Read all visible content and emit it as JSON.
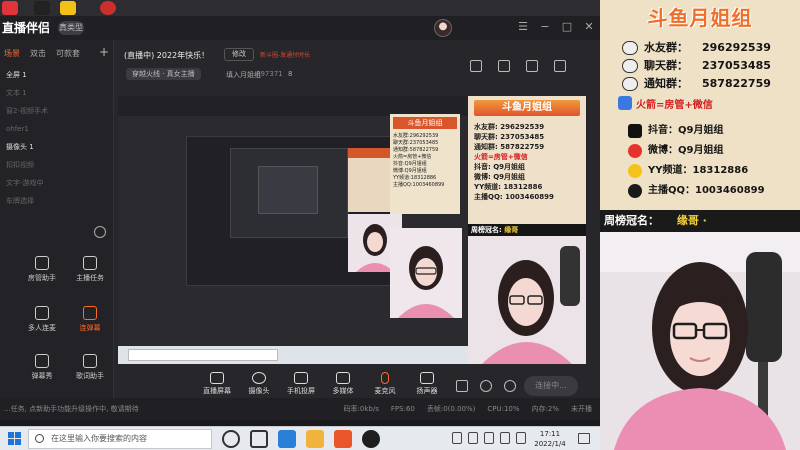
{
  "app": {
    "logo_text": "直播伴侣",
    "version_label": "真类型",
    "window_controls": [
      "☰",
      "−",
      "□",
      "✕"
    ]
  },
  "sidebar": {
    "tabs": [
      "场景",
      "双击",
      "可款套"
    ],
    "scenes": [
      {
        "label": "全屏 1",
        "bright": true
      },
      {
        "label": "文本 1",
        "bright": false
      },
      {
        "label": "窗2-视频手术",
        "bright": false
      },
      {
        "label": "ohfer1",
        "bright": false
      },
      {
        "label": "摄像头 1",
        "bright": true
      },
      {
        "label": "扣扣视频",
        "bright": false
      },
      {
        "label": "文字-游戏中",
        "bright": false
      },
      {
        "label": "车牌选择",
        "bright": false
      }
    ],
    "tools": [
      {
        "label": "房管助手",
        "hot": false
      },
      {
        "label": "主播任务",
        "hot": false
      },
      {
        "label": "多人连麦",
        "hot": false
      },
      {
        "label": "连弹幕",
        "hot": true
      },
      {
        "label": "弹幕秀",
        "hot": false
      },
      {
        "label": "歌词助手",
        "hot": false
      }
    ]
  },
  "room": {
    "title": "(直播中) 2022年快乐！",
    "modify_label": "修改",
    "warning": "新斗圈-发通付时长",
    "category": "穿越火线 · 真女主播",
    "subtitle": "填入月姐组",
    "room_id": "897371",
    "fans": "8"
  },
  "preview": {
    "big_panel_title": "斗鱼月姐组",
    "big_panel_lines": [
      "水友群: 296292539",
      "聊天群: 237053485",
      "通知群: 587822759",
      "火箭=房管+微信",
      "抖音: Q9月姐组",
      "微博: Q9月姐组",
      "YY频道: 18312886",
      "主播QQ: 1003460899"
    ],
    "crown_label": "周榜冠名:",
    "crown_name": "缘哥",
    "mini_panel_title": "斗鱼月姐组",
    "mini_panel_lines": [
      "水友群:296292539",
      "聊天群:237053485",
      "通知群:587822759",
      "火箭=房管+微信",
      "抖音:Q9月姐组",
      "微博:Q9月姐组",
      "YY频道:18312886",
      "主播QQ:1003460899"
    ]
  },
  "bottom_toolbar": {
    "tools": [
      "直播屏幕",
      "摄像头",
      "手机投屏",
      "多媒体",
      "麦克风",
      "扬声器"
    ],
    "start_label": "连接中..."
  },
  "status_bar": {
    "left_text": "...任务, 点新助手功能升级操作中, 敬请期待",
    "right_items": [
      "码率:0kb/s",
      "FPS:60",
      "丢帧:0(0.00%)",
      "CPU:10%",
      "内存:2%",
      "未开播"
    ]
  },
  "taskbar": {
    "search_placeholder": "在这里输入你要搜索的内容",
    "time": "17:11",
    "date": "2022/1/4"
  },
  "info_panel": {
    "title": "斗鱼月姐组",
    "groups": [
      {
        "label": "水友群：",
        "value": "296292539"
      },
      {
        "label": "聊天群：",
        "value": "237053485"
      },
      {
        "label": "通知群：",
        "value": "587822759"
      }
    ],
    "rocket_text": "火箭=房管+微信",
    "socials": [
      {
        "label": "抖音：",
        "value": "Q9月姐组"
      },
      {
        "label": "微博：",
        "value": "Q9月姐组"
      },
      {
        "label": "YY频道：",
        "value": "18312886"
      },
      {
        "label": "主播QQ：",
        "value": "1003460899"
      }
    ],
    "crown_label": "周榜冠名：",
    "crown_name": "缘哥 ·"
  },
  "colors": {
    "accent": "#ff6a2a",
    "panel_bg": "#efe1c6",
    "title_orange": "#ee6f2a",
    "rocket_red": "#d31f1f",
    "crown_gold": "#f3cf3a"
  }
}
